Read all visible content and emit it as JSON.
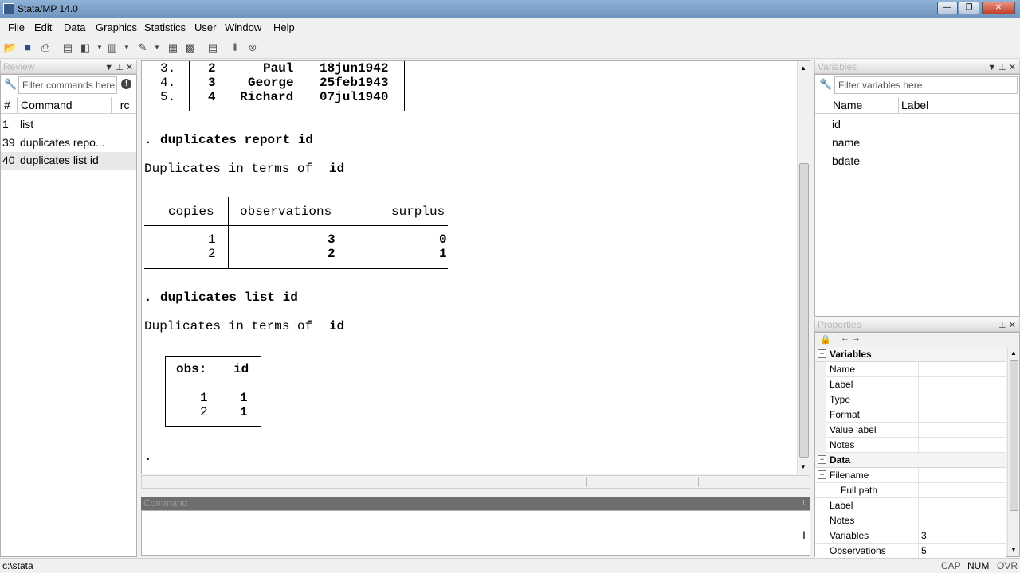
{
  "window": {
    "title": "Stata/MP 14.0",
    "min": "—",
    "max": "❐",
    "close": "✕"
  },
  "menu": [
    "File",
    "Edit",
    "Data",
    "Graphics",
    "Statistics",
    "User",
    "Window",
    "Help"
  ],
  "review": {
    "header": "Review",
    "filter_placeholder": "Filter commands here",
    "columns": {
      "num": "#",
      "command": "Command",
      "rc": "_rc"
    },
    "rows": [
      {
        "num": "1",
        "command": "list"
      },
      {
        "num": "39",
        "command": "duplicates repo..."
      },
      {
        "num": "40",
        "command": "duplicates list id"
      }
    ]
  },
  "results": {
    "list_rows": [
      {
        "obs": "3.",
        "id": "2",
        "name": "Paul",
        "bdate": "18jun1942"
      },
      {
        "obs": "4.",
        "id": "3",
        "name": "George",
        "bdate": "25feb1943"
      },
      {
        "obs": "5.",
        "id": "4",
        "name": "Richard",
        "bdate": "07jul1940"
      }
    ],
    "cmd1": "duplicates report id",
    "dup_text_prefix": "Duplicates in terms of",
    "dup_var": "id",
    "report_headers": {
      "copies": "copies",
      "observations": "observations",
      "surplus": "surplus"
    },
    "report_rows": [
      {
        "copies": "1",
        "observations": "3",
        "surplus": "0"
      },
      {
        "copies": "2",
        "observations": "2",
        "surplus": "1"
      }
    ],
    "cmd2": "duplicates list id",
    "list_headers": {
      "obs": "obs:",
      "id": "id"
    },
    "list2_rows": [
      {
        "obs": "1",
        "id": "1"
      },
      {
        "obs": "2",
        "id": "1"
      }
    ],
    "dot": ".",
    "prompt": "."
  },
  "command": {
    "header": "Command"
  },
  "variables": {
    "header": "Variables",
    "filter_placeholder": "Filter variables here",
    "columns": {
      "name": "Name",
      "label": "Label"
    },
    "rows": [
      "id",
      "name",
      "bdate"
    ]
  },
  "properties": {
    "header": "Properties",
    "sections": [
      {
        "title": "Variables",
        "rows": [
          {
            "label": "Name",
            "value": ""
          },
          {
            "label": "Label",
            "value": ""
          },
          {
            "label": "Type",
            "value": ""
          },
          {
            "label": "Format",
            "value": ""
          },
          {
            "label": "Value label",
            "value": ""
          },
          {
            "label": "Notes",
            "value": ""
          }
        ]
      },
      {
        "title": "Data",
        "rows": [
          {
            "label": "Filename",
            "value": ""
          },
          {
            "label": "Full path",
            "value": "",
            "indent": true
          },
          {
            "label": "Label",
            "value": ""
          },
          {
            "label": "Notes",
            "value": ""
          },
          {
            "label": "Variables",
            "value": "3"
          },
          {
            "label": "Observations",
            "value": "5"
          }
        ]
      }
    ]
  },
  "status": {
    "path": "c:\\stata",
    "cap": "CAP",
    "num": "NUM",
    "ovr": "OVR"
  }
}
